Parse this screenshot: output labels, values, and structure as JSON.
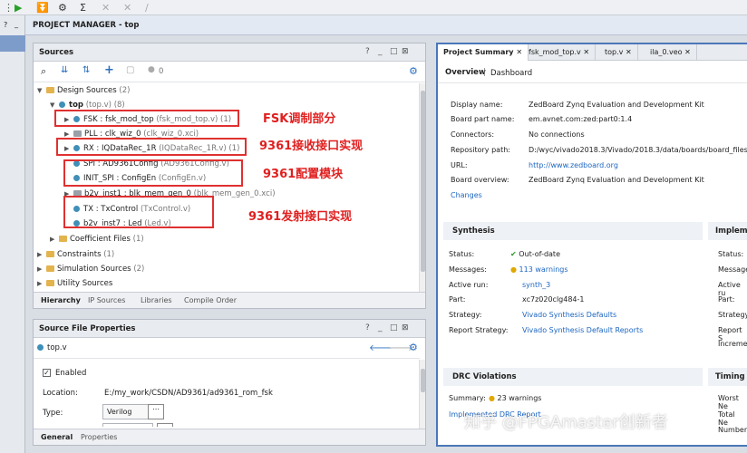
{
  "pm_title": "PROJECT MANAGER - top",
  "sources": {
    "title": "Sources",
    "controls": [
      "?",
      "_",
      "□",
      "⊠"
    ],
    "count": "0",
    "design_sources": "Design Sources",
    "design_sources_count": "(2)",
    "top": "top",
    "top_meta": "(top.v) (8)",
    "items": [
      {
        "label": "FSK : fsk_mod_top",
        "meta": "(fsk_mod_top.v) (1)"
      },
      {
        "label": "PLL : clk_wiz_0",
        "meta": "(clk_wiz_0.xci)"
      },
      {
        "label": "RX : IQDataRec_1R",
        "meta": "(IQDataRec_1R.v) (1)"
      },
      {
        "label": "SPI : AD9361Config",
        "meta": "(AD9361Config.v)"
      },
      {
        "label": "INIT_SPI : ConfigEn",
        "meta": "(ConfigEn.v)"
      },
      {
        "label": "b2v_inst1 : blk_mem_gen_0",
        "meta": "(blk_mem_gen_0.xci)"
      },
      {
        "label": "TX : TxControl",
        "meta": "(TxControl.v)"
      },
      {
        "label": "b2v_inst7 : Led",
        "meta": "(Led.v)"
      }
    ],
    "coef": "Coefficient Files",
    "coef_count": "(1)",
    "constraints": "Constraints",
    "constraints_count": "(1)",
    "sim": "Simulation Sources",
    "sim_count": "(2)",
    "util": "Utility Sources",
    "tabs": [
      "Hierarchy",
      "IP Sources",
      "Libraries",
      "Compile Order"
    ]
  },
  "annotations": [
    "FSK调制部分",
    "9361接收接口实现",
    "9361配置模块",
    "9361发射接口实现"
  ],
  "props": {
    "title": "Source File Properties",
    "file": "top.v",
    "enabled": "Enabled",
    "location_label": "Location:",
    "location_value": "E:/my_work/CSDN/AD9361/ad9361_rom_fsk",
    "type_label": "Type:",
    "type_value": "Verilog",
    "tabs": [
      "General",
      "Properties"
    ]
  },
  "summary": {
    "tabs": [
      "Project Summary",
      "fsk_mod_top.v",
      "top.v",
      "ila_0.veo"
    ],
    "subtabs": [
      "Overview",
      "Dashboard"
    ],
    "info": [
      {
        "k": "Display name:",
        "v": "ZedBoard Zynq Evaluation and Development Kit"
      },
      {
        "k": "Board part name:",
        "v": "em.avnet.com:zed:part0:1.4"
      },
      {
        "k": "Connectors:",
        "v": "No connections"
      },
      {
        "k": "Repository path:",
        "v": "D:/wyc/vivado2018.3/Vivado/2018.3/data/boards/board_files"
      },
      {
        "k": "URL:",
        "v": "http://www.zedboard.org"
      },
      {
        "k": "Board overview:",
        "v": "ZedBoard Zynq Evaluation and Development Kit"
      }
    ],
    "changes": "Changes",
    "synthesis": "Synthesis",
    "synth_rows": [
      {
        "k": "Status:",
        "v": "Out-of-date"
      },
      {
        "k": "Messages:",
        "v": "113 warnings"
      },
      {
        "k": "Active run:",
        "v": "synth_3"
      },
      {
        "k": "Part:",
        "v": "xc7z020clg484-1"
      },
      {
        "k": "Strategy:",
        "v": "Vivado Synthesis Defaults"
      },
      {
        "k": "Report Strategy:",
        "v": "Vivado Synthesis Default Reports"
      }
    ],
    "impl": "Impleme",
    "impl_rows": [
      "Status:",
      "Message",
      "Active ru",
      "Part:",
      "Strategy:",
      "Report S",
      "Increme"
    ],
    "drc": "DRC Violations",
    "drc_summary_k": "Summary:",
    "drc_summary_v": "23 warnings",
    "drc_link": "Implemented DRC Report",
    "timing": "Timing",
    "timing_rows": [
      "Worst Ne",
      "Total Ne",
      "Number"
    ]
  },
  "watermark": "知乎 @FPGAmaster创新者"
}
